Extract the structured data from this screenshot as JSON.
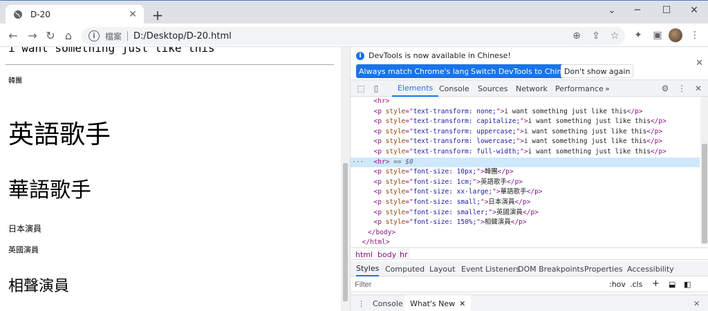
{
  "browser": {
    "tab_title": "D-20",
    "tab_close": "✕",
    "new_tab": "+",
    "scheme_label": "檔案",
    "url": "D:/Desktop/D-20.html"
  },
  "page": {
    "top_text": "i want something just like this",
    "lines": [
      "韓團",
      "英語歌手",
      "華語歌手",
      "日本演員",
      "英國演員",
      "相聲演員"
    ]
  },
  "devtools": {
    "info_message": "DevTools is now available in Chinese!",
    "btn_match": "Always match Chrome's language",
    "btn_switch": "Switch DevTools to Chinese",
    "btn_dont_show": "Don't show again",
    "tabs": [
      "Elements",
      "Console",
      "Sources",
      "Network",
      "Performance"
    ],
    "more_tabs": "»",
    "dom": [
      {
        "indent": 3,
        "parts": [
          [
            "tag",
            "<hr>"
          ]
        ]
      },
      {
        "indent": 3,
        "parts": [
          [
            "tag",
            "<p "
          ],
          [
            "attr",
            "style"
          ],
          [
            "tag",
            "=\""
          ],
          [
            "val",
            "text-transform: none;"
          ],
          [
            "tag",
            "\">"
          ],
          [
            "txt",
            "i want something just like this"
          ],
          [
            "tag",
            "</p>"
          ]
        ]
      },
      {
        "indent": 3,
        "parts": [
          [
            "tag",
            "<p "
          ],
          [
            "attr",
            "style"
          ],
          [
            "tag",
            "=\""
          ],
          [
            "val",
            "text-transform: capitalize;"
          ],
          [
            "tag",
            "\">"
          ],
          [
            "txt",
            "i want something just like this"
          ],
          [
            "tag",
            "</p>"
          ]
        ]
      },
      {
        "indent": 3,
        "parts": [
          [
            "tag",
            "<p "
          ],
          [
            "attr",
            "style"
          ],
          [
            "tag",
            "=\""
          ],
          [
            "val",
            "text-transform: uppercase;"
          ],
          [
            "tag",
            "\">"
          ],
          [
            "txt",
            "i want something just like this"
          ],
          [
            "tag",
            "</p>"
          ]
        ]
      },
      {
        "indent": 3,
        "parts": [
          [
            "tag",
            "<p "
          ],
          [
            "attr",
            "style"
          ],
          [
            "tag",
            "=\""
          ],
          [
            "val",
            "text-transform: lowercase;"
          ],
          [
            "tag",
            "\">"
          ],
          [
            "txt",
            "i want something just like this"
          ],
          [
            "tag",
            "</p>"
          ]
        ]
      },
      {
        "indent": 3,
        "parts": [
          [
            "tag",
            "<p "
          ],
          [
            "attr",
            "style"
          ],
          [
            "tag",
            "=\""
          ],
          [
            "val",
            "text-transform: full-width;"
          ],
          [
            "tag",
            "\">"
          ],
          [
            "txt",
            "i want something just like this"
          ],
          [
            "tag",
            "</p>"
          ]
        ]
      },
      {
        "indent": 3,
        "selected": true,
        "parts": [
          [
            "tag",
            "<hr>"
          ],
          [
            "dim",
            " == $0"
          ]
        ]
      },
      {
        "indent": 3,
        "parts": [
          [
            "tag",
            "<p "
          ],
          [
            "attr",
            "style"
          ],
          [
            "tag",
            "=\""
          ],
          [
            "val",
            "font-size: 10px;"
          ],
          [
            "tag",
            "\">"
          ],
          [
            "txt",
            "韓團"
          ],
          [
            "tag",
            "</p>"
          ]
        ]
      },
      {
        "indent": 3,
        "parts": [
          [
            "tag",
            "<p "
          ],
          [
            "attr",
            "style"
          ],
          [
            "tag",
            "=\""
          ],
          [
            "val",
            "font-size: 1cm;"
          ],
          [
            "tag",
            "\">"
          ],
          [
            "txt",
            "英語歌手"
          ],
          [
            "tag",
            "</p>"
          ]
        ]
      },
      {
        "indent": 3,
        "parts": [
          [
            "tag",
            "<p "
          ],
          [
            "attr",
            "style"
          ],
          [
            "tag",
            "=\""
          ],
          [
            "val",
            "font-size: xx-large;"
          ],
          [
            "tag",
            "\">"
          ],
          [
            "txt",
            "華語歌手"
          ],
          [
            "tag",
            "</p>"
          ]
        ]
      },
      {
        "indent": 3,
        "parts": [
          [
            "tag",
            "<p "
          ],
          [
            "attr",
            "style"
          ],
          [
            "tag",
            "=\""
          ],
          [
            "val",
            "font-size: small;"
          ],
          [
            "tag",
            "\">"
          ],
          [
            "txt",
            "日本演員"
          ],
          [
            "tag",
            "</p>"
          ]
        ]
      },
      {
        "indent": 3,
        "parts": [
          [
            "tag",
            "<p "
          ],
          [
            "attr",
            "style"
          ],
          [
            "tag",
            "=\""
          ],
          [
            "val",
            "font-size: smaller;"
          ],
          [
            "tag",
            "\">"
          ],
          [
            "txt",
            "英國演員"
          ],
          [
            "tag",
            "</p>"
          ]
        ]
      },
      {
        "indent": 3,
        "parts": [
          [
            "tag",
            "<p "
          ],
          [
            "attr",
            "style"
          ],
          [
            "tag",
            "=\""
          ],
          [
            "val",
            "font-size: 150%;"
          ],
          [
            "tag",
            "\">"
          ],
          [
            "txt",
            "相聲演員"
          ],
          [
            "tag",
            "</p>"
          ]
        ]
      },
      {
        "indent": 2,
        "parts": [
          [
            "tag",
            "</body>"
          ]
        ]
      },
      {
        "indent": 1,
        "parts": [
          [
            "tag",
            "</html>"
          ]
        ]
      }
    ],
    "breadcrumbs": [
      "html",
      "body",
      "hr"
    ],
    "sub_tabs": [
      "Styles",
      "Computed",
      "Layout",
      "Event Listeners",
      "DOM Breakpoints",
      "Properties",
      "Accessibility"
    ],
    "filter_placeholder": "Filter",
    "filter_hov": ":hov",
    "filter_cls": ".cls",
    "filter_plus": "+",
    "drawer_console": "Console",
    "drawer_whats_new": "What's New",
    "drawer_close": "✕"
  },
  "colors": {
    "accent": "#1a73e8",
    "selected_row": "#cfe8fc",
    "tag": "#881280",
    "attr": "#994500",
    "value": "#1a1aa6"
  },
  "icons": [
    "globe-icon",
    "back-icon",
    "forward-icon",
    "reload-icon",
    "home-icon",
    "info-icon",
    "zoom-icon",
    "share-icon",
    "star-icon",
    "extensions-icon",
    "sidepanel-icon",
    "menu-icon",
    "inspect-icon",
    "device-icon",
    "gear-icon",
    "kebab-icon",
    "close-icon"
  ]
}
